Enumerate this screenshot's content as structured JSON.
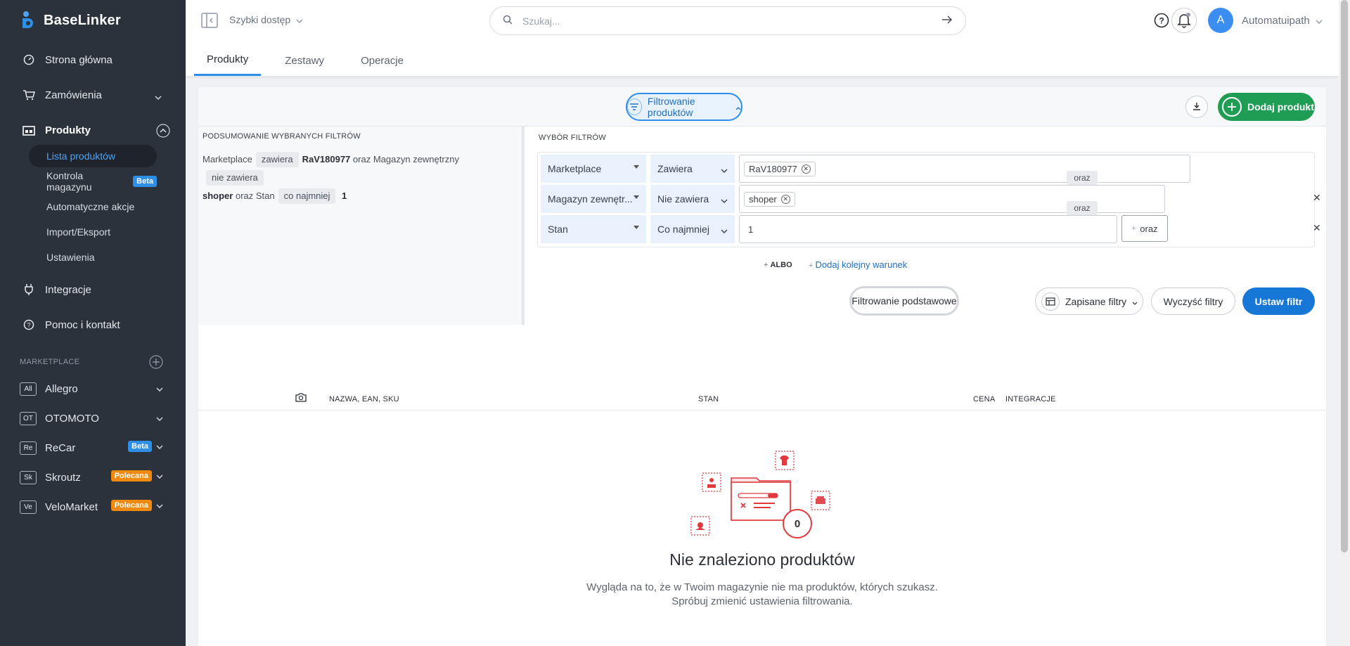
{
  "brand": {
    "name": "BaseLinker"
  },
  "sidebar": {
    "items": [
      {
        "label": "Strona główna"
      },
      {
        "label": "Zamówienia"
      },
      {
        "label": "Produkty"
      },
      {
        "label": "Integracje"
      },
      {
        "label": "Pomoc i kontakt"
      }
    ],
    "sub_items": [
      {
        "label": "Lista produktów"
      },
      {
        "label": "Kontrola magazynu",
        "badge": "Beta"
      },
      {
        "label": "Automatyczne akcje"
      },
      {
        "label": "Import/Eksport"
      },
      {
        "label": "Ustawienia"
      }
    ],
    "section_label": "MARKETPLACE",
    "marketplaces": [
      {
        "tag": "All",
        "label": "Allegro"
      },
      {
        "tag": "OT",
        "label": "OTOMOTO"
      },
      {
        "tag": "Re",
        "label": "ReCar",
        "badge": "Beta"
      },
      {
        "tag": "Sk",
        "label": "Skroutz",
        "badge": "Polecana"
      },
      {
        "tag": "Ve",
        "label": "VeloMarket",
        "badge": "Polecana"
      }
    ]
  },
  "topbar": {
    "quick_access": "Szybki dostęp",
    "search_placeholder": "Szukaj...",
    "avatar_letter": "A",
    "username": "Automatuipath",
    "tabs": [
      {
        "label": "Produkty"
      },
      {
        "label": "Zestawy"
      },
      {
        "label": "Operacje"
      }
    ]
  },
  "filter_bar": {
    "toggle_label": "Filtrowanie produktów",
    "add_label": "Dodaj produkt"
  },
  "summary": {
    "title": "PODSUMOWANIE WYBRANYCH FILTRÓW",
    "field1": "Marketplace",
    "op1": "zawiera",
    "val1": "RaV180977",
    "conj1": "oraz",
    "field2": "Magazyn zewnętrzny",
    "op2": "nie zawiera",
    "val2": "shoper",
    "conj2": "oraz",
    "field3": "Stan",
    "op3": "co najmniej",
    "val3": "1"
  },
  "filters": {
    "title": "WYBÓR FILTRÓW",
    "rows": [
      {
        "field": "Marketplace",
        "operator": "Zawiera",
        "value": "RaV180977"
      },
      {
        "field": "Magazyn zewnętr...",
        "operator": "Nie zawiera",
        "value": "shoper"
      },
      {
        "field": "Stan",
        "operator": "Co najmniej",
        "value": "1"
      }
    ],
    "and_tag": "oraz",
    "and_button": "oraz",
    "or_link": "ALBO",
    "add_condition": "Dodaj kolejny warunek",
    "basic_button": "Filtrowanie podstawowe",
    "saved_button": "Zapisane filtry",
    "clear_button": "Wyczyść filtry",
    "apply_button": "Ustaw filtr"
  },
  "table": {
    "columns": {
      "name": "NAZWA, EAN, SKU",
      "stock": "STAN",
      "price": "CENA",
      "integrations": "INTEGRACJE"
    }
  },
  "empty": {
    "count": "0",
    "title": "Nie znaleziono produktów",
    "desc": "Wygląda na to, że w Twoim magazynie nie ma produktów, których szukasz. Spróbuj zmienić ustawienia filtrowania."
  },
  "colors": {
    "accent": "#2f8ee5",
    "success": "#1f9d55",
    "sidebar": "#2c323c",
    "warning": "#ee8a10",
    "illustration": "#e0393e"
  }
}
